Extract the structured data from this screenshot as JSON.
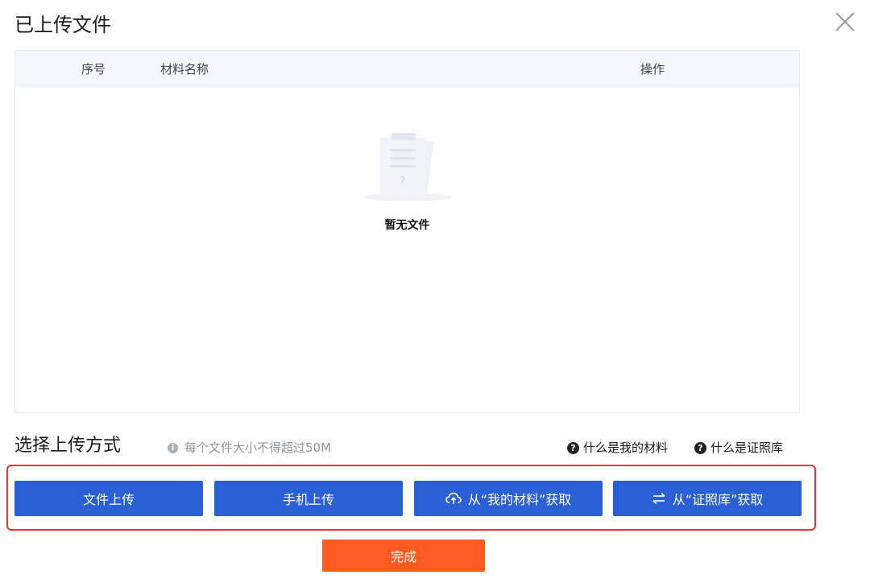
{
  "dialog": {
    "title": "已上传文件",
    "close_icon": "close-icon"
  },
  "table": {
    "columns": [
      "序号",
      "材料名称",
      "操作"
    ],
    "rows": [],
    "empty_text": "暂无文件",
    "empty_icon": "empty-document-icon"
  },
  "upload": {
    "section_title": "选择上传方式",
    "size_hint": "每个文件大小不得超过50M",
    "size_hint_icon": "info-icon",
    "help_links": [
      {
        "label": "什么是我的材料",
        "icon": "question-icon"
      },
      {
        "label": "什么是证照库",
        "icon": "question-icon"
      }
    ],
    "buttons": [
      {
        "label": "文件上传"
      },
      {
        "label": "手机上传"
      },
      {
        "label": "从“我的材料”获取",
        "icon": "cloud-upload-icon"
      },
      {
        "label": "从“证照库”获取",
        "icon": "swap-arrows-icon"
      }
    ]
  },
  "footer": {
    "done_label": "完成"
  },
  "colors": {
    "primary": "#2a5fd6",
    "accent": "#ff5a1f",
    "highlight": "#ff2d2d",
    "table_header": "#f3f6fc"
  }
}
